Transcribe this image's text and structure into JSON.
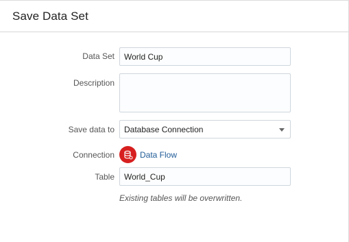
{
  "dialog": {
    "title": "Save Data Set"
  },
  "form": {
    "data_set": {
      "label": "Data Set",
      "value": "World Cup"
    },
    "description": {
      "label": "Description",
      "value": ""
    },
    "save_data_to": {
      "label": "Save data to",
      "selected": "Database Connection"
    },
    "connection": {
      "label": "Connection",
      "icon": "database-icon",
      "icon_color": "#d71f1f",
      "value": "Data Flow"
    },
    "table": {
      "label": "Table",
      "value": "World_Cup"
    },
    "hint": "Existing tables will be overwritten."
  }
}
